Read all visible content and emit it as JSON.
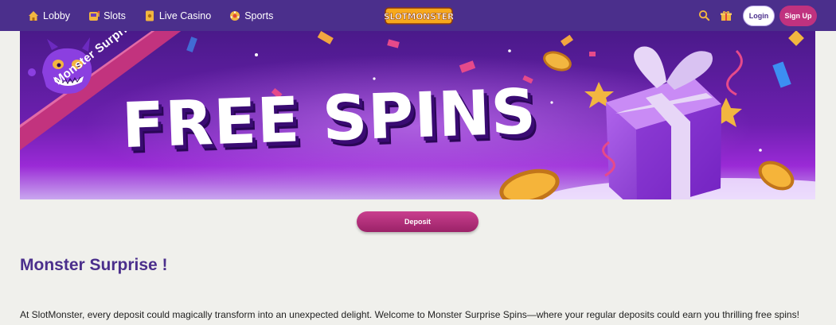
{
  "nav": {
    "items": [
      {
        "label": "Lobby",
        "icon": "home-icon"
      },
      {
        "label": "Slots",
        "icon": "slot-machine-icon"
      },
      {
        "label": "Live Casino",
        "icon": "playing-card-icon"
      },
      {
        "label": "Sports",
        "icon": "ball-icon"
      }
    ],
    "logo_text": "SLOTMONSTER",
    "login_label": "Login",
    "signup_label": "Sign Up"
  },
  "banner": {
    "ribbon_text": "Monster Surprise",
    "headline": "FREE SPINS"
  },
  "deposit_label": "Deposit",
  "content": {
    "title": "Monster Surprise !",
    "description": "At SlotMonster, every deposit could magically transform into an unexpected delight. Welcome to Monster Surprise Spins—where your regular deposits could earn you thrilling free spins!"
  },
  "colors": {
    "nav_bg": "#4b2f8c",
    "accent_pink": "#c0327f",
    "title_purple": "#4b2f8c",
    "page_bg": "#f0f0ec"
  }
}
